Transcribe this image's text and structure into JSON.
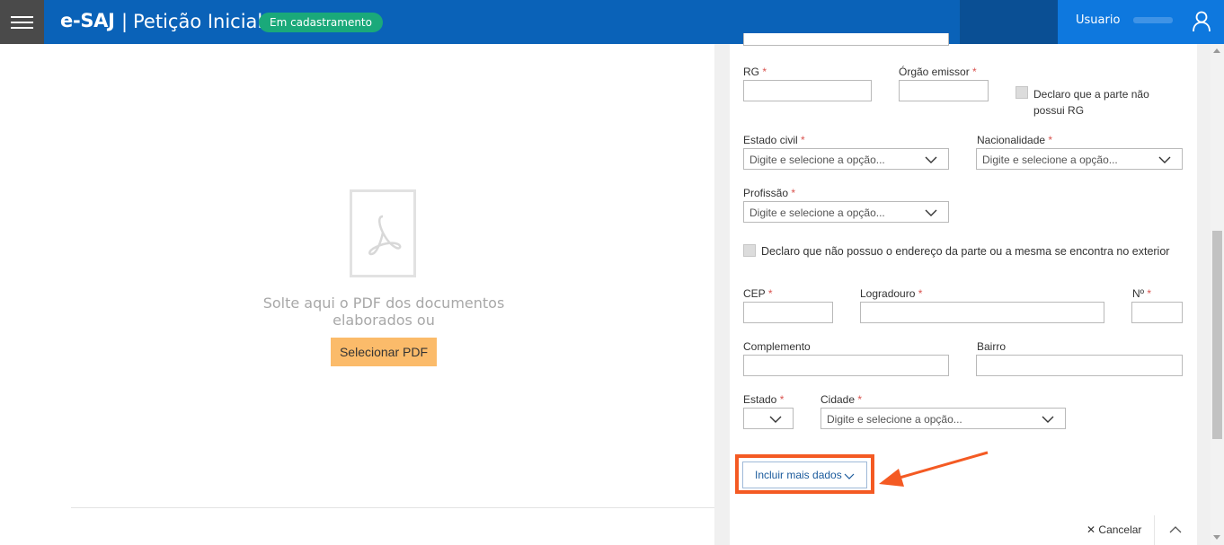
{
  "header": {
    "brand": "e-SAJ",
    "separator": "|",
    "title": "Petição Inicial",
    "status_badge": "Em cadastramento",
    "user_label": "Usuario",
    "menu_icon": "hamburger-menu-icon",
    "user_icon": "user-icon"
  },
  "drop_zone": {
    "icon": "pdf-file-icon",
    "text": "Solte aqui o PDF dos documentos elaborados ou",
    "select_button": "Selecionar PDF"
  },
  "form": {
    "required_mark": "*",
    "rg": {
      "label": "RG",
      "value": ""
    },
    "orgao_emissor": {
      "label": "Órgão emissor",
      "value": ""
    },
    "no_rg_checkbox": {
      "label": "Declaro que a parte não possui RG",
      "checked": false
    },
    "estado_civil": {
      "label": "Estado civil",
      "placeholder": "Digite e selecione a opção..."
    },
    "nacionalidade": {
      "label": "Nacionalidade",
      "placeholder": "Digite e selecione a opção..."
    },
    "profissao": {
      "label": "Profissão",
      "placeholder": "Digite e selecione a opção..."
    },
    "no_address_checkbox": {
      "label": "Declaro que não possuo o endereço da parte ou a mesma se encontra no exterior",
      "checked": false
    },
    "cep": {
      "label": "CEP",
      "value": ""
    },
    "logradouro": {
      "label": "Logradouro",
      "value": ""
    },
    "numero": {
      "label": "Nº",
      "value": ""
    },
    "complemento": {
      "label": "Complemento",
      "value": ""
    },
    "bairro": {
      "label": "Bairro",
      "value": ""
    },
    "estado": {
      "label": "Estado",
      "value": ""
    },
    "cidade": {
      "label": "Cidade",
      "placeholder": "Digite e selecione a opção..."
    },
    "more_button": "Incluir mais dados",
    "cancel": "Cancelar"
  },
  "colors": {
    "header_blue": "#0a62b8",
    "user_blue": "#0e78de",
    "badge_green": "#1aa97a",
    "pdf_button": "#fbbb6a",
    "required_red": "#d9534f",
    "highlight_orange": "#f45a23"
  }
}
